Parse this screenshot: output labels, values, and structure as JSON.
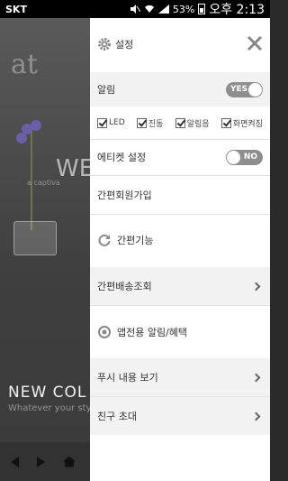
{
  "status_bar": {
    "carrier": "SKT",
    "battery": "53%",
    "time": "오후 2:13"
  },
  "background": {
    "logo": "at",
    "we": "WE",
    "caption": "a captiva",
    "title": "NEW COL",
    "subtitle": "Whatever your sty"
  },
  "drawer": {
    "settings_label": "설정",
    "alarm_label": "알림",
    "alarm_toggle": "YES",
    "checks": [
      "LED",
      "진동",
      "알림음",
      "화면켜짐"
    ],
    "etiquette_label": "에티켓 설정",
    "etiquette_toggle": "NO",
    "easy_signup": "간편회원가입",
    "easy_function": "간편기능",
    "easy_shipping": "간편배송조회",
    "app_alarm": "앱전용 알림/혜택",
    "push_view": "푸시 내용 보기",
    "invite": "친구 초대"
  }
}
